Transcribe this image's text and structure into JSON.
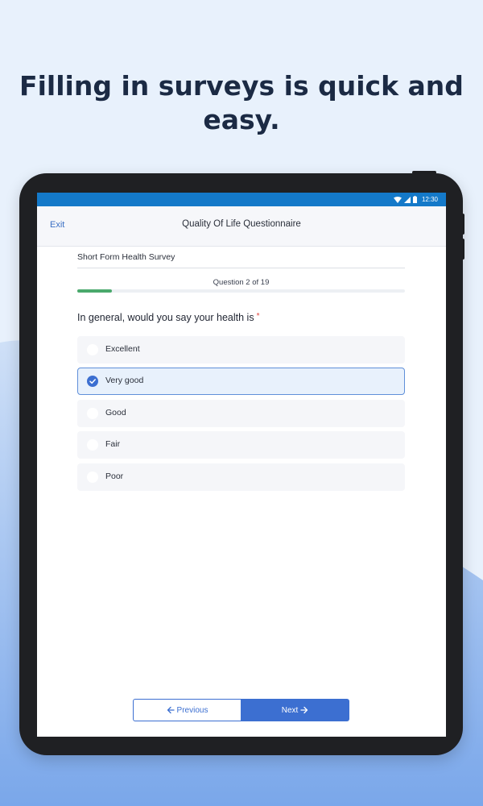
{
  "headline": [
    "Filling in surveys is quick and",
    "easy."
  ],
  "status_bar": {
    "time": "12:30",
    "icons": [
      "wifi-icon",
      "signal-icon",
      "battery-icon"
    ]
  },
  "app_bar": {
    "exit_label": "Exit",
    "title": "Quality Of Life Questionnaire"
  },
  "survey": {
    "title": "Short Form Health Survey",
    "progress_label": "Question 2 of 19",
    "progress_fraction": 0.105,
    "question": "In general, would you say your health is",
    "required_marker": "*",
    "options": [
      {
        "label": "Excellent",
        "selected": false
      },
      {
        "label": "Very good",
        "selected": true
      },
      {
        "label": "Good",
        "selected": false
      },
      {
        "label": "Fair",
        "selected": false
      },
      {
        "label": "Poor",
        "selected": false
      }
    ]
  },
  "navigation": {
    "previous_label": "Previous",
    "next_label": "Next"
  },
  "colors": {
    "accent": "#3c6fd1",
    "status_bar": "#1479c9",
    "progress": "#4aa96c",
    "required": "#e0413a",
    "headline": "#1b2a44"
  }
}
